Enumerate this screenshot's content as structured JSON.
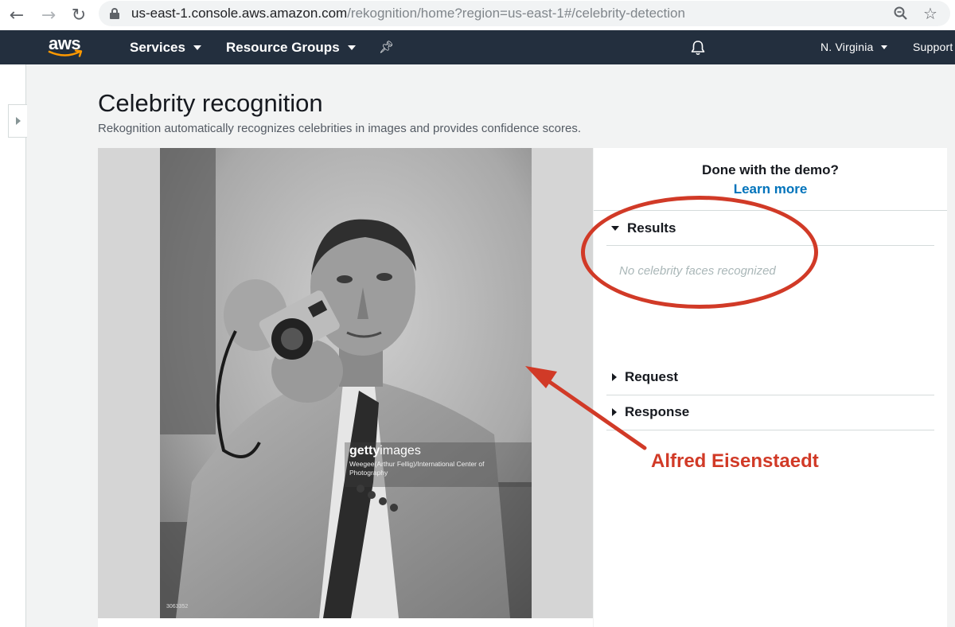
{
  "browser": {
    "url_host": "us-east-1.console.aws.amazon.com",
    "url_path": "/rekognition/home?region=us-east-1#/celebrity-detection"
  },
  "aws_nav": {
    "logo_text": "aws",
    "services_label": "Services",
    "resource_groups_label": "Resource Groups",
    "region_label": "N. Virginia",
    "support_label": "Support",
    "bg_color": "#232f3e"
  },
  "page": {
    "title": "Celebrity recognition",
    "subtitle": "Rekognition automatically recognizes celebrities in images and provides confidence scores."
  },
  "image": {
    "watermark_brand": "getty",
    "watermark_brand_suffix": "images",
    "watermark_credit": "Weegee(Arthur Fellig)/International Center of Photography",
    "photo_id": "3063352"
  },
  "side_panel": {
    "demo_question": "Done with the demo?",
    "learn_more": "Learn more",
    "results_label": "Results",
    "results_empty": "No celebrity faces recognized",
    "request_label": "Request",
    "response_label": "Response",
    "link_color": "#0073bb"
  },
  "annotation": {
    "label": "Alfred Eisenstaedt",
    "color": "#d13a27"
  }
}
